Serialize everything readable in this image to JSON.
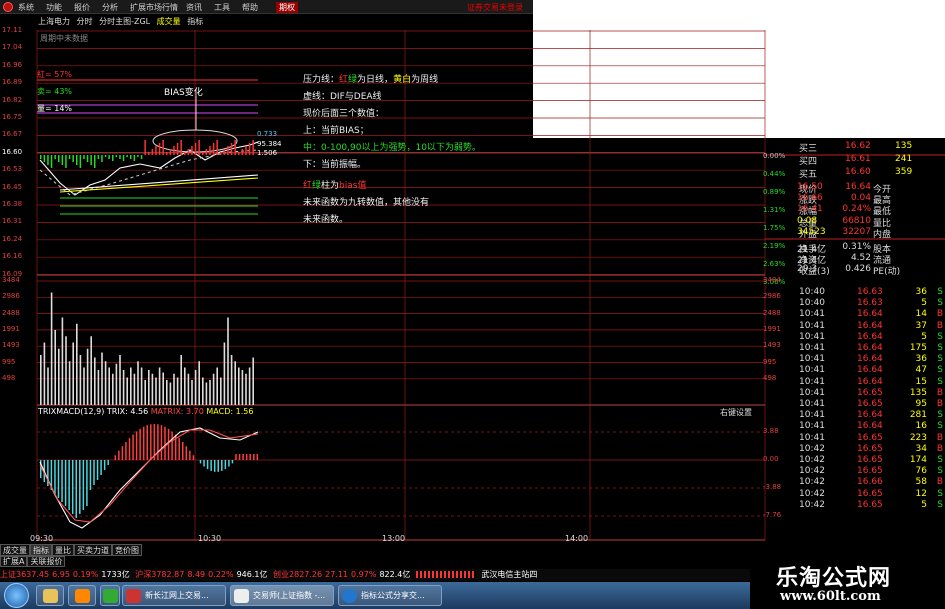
{
  "menu": [
    "系统",
    "功能",
    "报价",
    "分析",
    "扩展市场行情",
    "资讯",
    "工具",
    "帮助",
    "期权"
  ],
  "login_link": "证券交易未登录",
  "info": {
    "stock": "上海电力",
    "mode1": "分时",
    "mode2": "分时主图-ZGL",
    "vol": "成交量",
    "ind": "指标"
  },
  "no_data": "周期中未数据",
  "bias_pct": {
    "red": "紅= 57%",
    "green": "卖= 43%",
    "violet": "量= 14%"
  },
  "price_labels": [
    "17.11",
    "17.04",
    "16.96",
    "16.89",
    "16.82",
    "16.75",
    "16.67",
    "16.60",
    "16.53",
    "16.45",
    "16.38",
    "16.31",
    "16.24",
    "16.16",
    "16.09"
  ],
  "vol_labels": [
    "3484",
    "2986",
    "2488",
    "1991",
    "1493",
    "995",
    "498"
  ],
  "pct_labels_right": [
    {
      "t": "0.00%",
      "c": "#c0c0c0"
    },
    {
      "t": "0.44%",
      "c": "#2d2"
    },
    {
      "t": "0.89%",
      "c": "#2d2"
    },
    {
      "t": "1.31%",
      "c": "#2d2"
    },
    {
      "t": "1.75%",
      "c": "#2d2"
    },
    {
      "t": "2.19%",
      "c": "#2d2"
    },
    {
      "t": "2.63%",
      "c": "#2d2"
    },
    {
      "t": "3.06%",
      "c": "#2d2"
    }
  ],
  "macd_labels": [
    "3.88",
    "0.00",
    "-3.88",
    "-7.76"
  ],
  "chart_tags": {
    "v1": "0.733",
    "v2": "95.384",
    "v3": "1.506"
  },
  "bias_label": "BIAS变化",
  "annotation": {
    "l1a": "压力线：",
    "l1b": "红",
    "l1c": "绿",
    "l1d": "为日线，",
    "l1e": "黄白",
    "l1f": "为周线",
    "l2": "虚线：DIF与DEA线",
    "l3": "现价后面三个数值：",
    "l4": "上：当前BIAS；",
    "l5": "中：0-100,90以上为强势，10以下为弱势。",
    "l6": "下：当前振幅。",
    "l7a": "红",
    "l7b": "绿",
    "l7c": "柱为",
    "l7d": "bias值",
    "l8": "未来函数为九转数值，其他没有",
    "l9": "未来函数。"
  },
  "macd_title": {
    "a": "TRIXMACD(12,9)",
    "b": "TRIX: 4.56",
    "c": "MATRIX: 3.70",
    "d": "MACD: 1.56"
  },
  "right_click": "右键设置",
  "xaxis": [
    "09:30",
    "10:30",
    "13:00",
    "14:00"
  ],
  "tabs": [
    "成交量",
    "指标",
    "量比",
    "买卖力道",
    "竞价图"
  ],
  "subtabs": [
    "扩展A",
    "关联报价"
  ],
  "quote": {
    "asks": [
      {
        "n": "买三",
        "p": "16.62",
        "v": "135"
      },
      {
        "n": "买四",
        "p": "16.61",
        "v": "241"
      },
      {
        "n": "买五",
        "p": "16.60",
        "v": "359"
      }
    ],
    "rows": [
      {
        "a": "现价",
        "b": "16.64",
        "c": "今开",
        "d": "16.50"
      },
      {
        "a": "涨跌",
        "b": "0.04",
        "c": "最高",
        "d": "16.66"
      },
      {
        "a": "涨幅",
        "b": "0.24%",
        "c": "最低",
        "d": "16.41"
      },
      {
        "a": "总量",
        "b": "66810",
        "c": "量比",
        "d": "0.08"
      },
      {
        "a": "外盘",
        "b": "32207",
        "c": "内盘",
        "d": "34523"
      },
      {
        "a": "换手",
        "b": "0.31%",
        "c": "股本",
        "d": "21.4亿"
      },
      {
        "a": "净资",
        "b": "4.52",
        "c": "流通",
        "d": "21.4亿"
      },
      {
        "a": "收益(3)",
        "b": "0.426",
        "c": "PE(动)",
        "d": "29.3"
      }
    ],
    "trades": [
      {
        "t": "10:40",
        "p": "16.63",
        "v": "36",
        "s": "S"
      },
      {
        "t": "10:40",
        "p": "16.63",
        "v": "5",
        "s": "S"
      },
      {
        "t": "10:41",
        "p": "16.64",
        "v": "14",
        "s": "B"
      },
      {
        "t": "10:41",
        "p": "16.64",
        "v": "37",
        "s": "B"
      },
      {
        "t": "10:41",
        "p": "16.64",
        "v": "5",
        "s": "S"
      },
      {
        "t": "10:41",
        "p": "16.64",
        "v": "175",
        "s": "S"
      },
      {
        "t": "10:41",
        "p": "16.64",
        "v": "36",
        "s": "S"
      },
      {
        "t": "10:41",
        "p": "16.64",
        "v": "47",
        "s": "S"
      },
      {
        "t": "10:41",
        "p": "16.64",
        "v": "15",
        "s": "S"
      },
      {
        "t": "10:41",
        "p": "16.65",
        "v": "135",
        "s": "B"
      },
      {
        "t": "10:41",
        "p": "16.65",
        "v": "95",
        "s": "B"
      },
      {
        "t": "10:41",
        "p": "16.64",
        "v": "281",
        "s": "S"
      },
      {
        "t": "10:41",
        "p": "16.64",
        "v": "16",
        "s": "S"
      },
      {
        "t": "10:41",
        "p": "16.65",
        "v": "223",
        "s": "B"
      },
      {
        "t": "10:42",
        "p": "16.65",
        "v": "34",
        "s": "B"
      },
      {
        "t": "10:42",
        "p": "16.65",
        "v": "174",
        "s": "S"
      },
      {
        "t": "10:42",
        "p": "16.65",
        "v": "76",
        "s": "S"
      },
      {
        "t": "10:42",
        "p": "16.66",
        "v": "58",
        "s": "B"
      },
      {
        "t": "10:42",
        "p": "16.65",
        "v": "12",
        "s": "S"
      },
      {
        "t": "10:42",
        "p": "16.65",
        "v": "5",
        "s": "S"
      }
    ]
  },
  "status": {
    "sh": "上证3637.45",
    "sh_chg": "6.95",
    "sh_pct": "0.19%",
    "sh_amt": "1733亿",
    "sz": "沪深3782.87",
    "sz_chg": "8.49",
    "sz_pct": "0.22%",
    "sz_amt": "946.1亿",
    "cy": "创业2827.26",
    "cy_chg": "27.11",
    "cy_pct": "0.97%",
    "cy_amt": "822.4亿",
    "server": "武汉电信主站四"
  },
  "taskbar": [
    {
      "label": "新长江网上交易...",
      "c": "#c33"
    },
    {
      "label": "交易师(上证指数 -...",
      "c": "#333"
    },
    {
      "label": "指标公式分享交...",
      "c": "#27c"
    }
  ],
  "watermark": {
    "t1": "乐淘公式网",
    "t2": "www.60lt.com"
  },
  "colors": {
    "up": "#ff3333",
    "down": "#22dd22",
    "grid": "#9a1a1a",
    "yellow": "#ffff00"
  }
}
